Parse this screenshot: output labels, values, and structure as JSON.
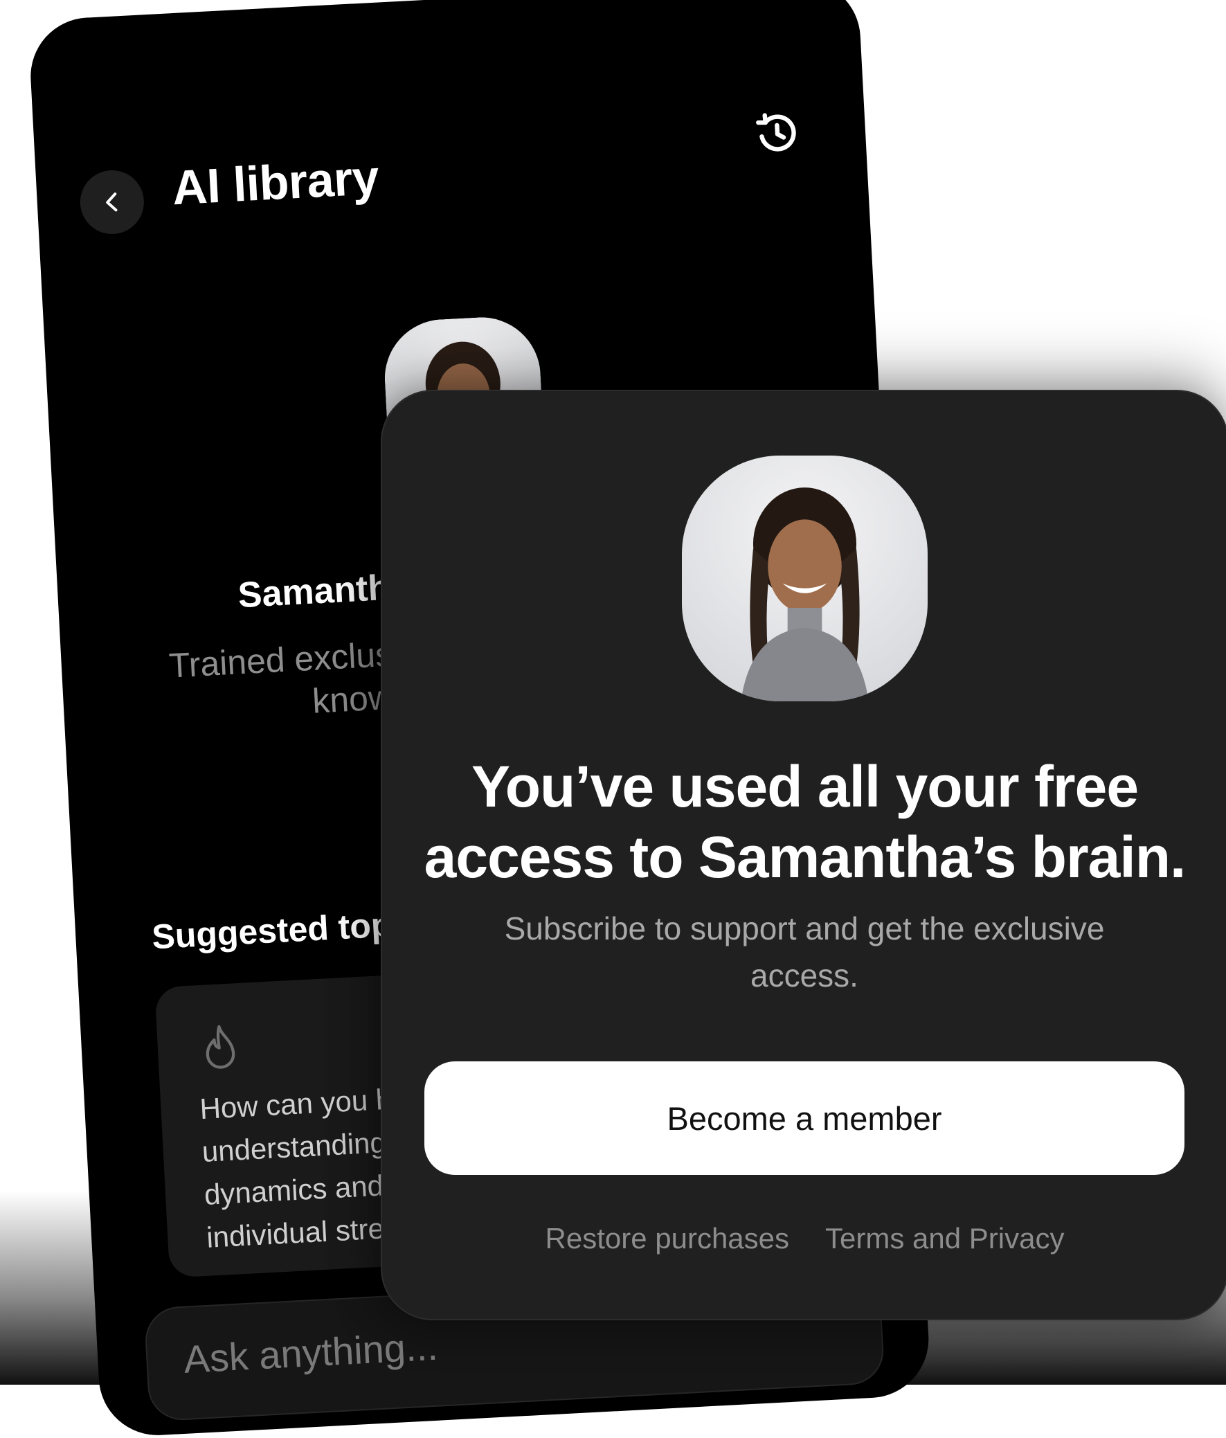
{
  "back_screen": {
    "title": "AI library",
    "icons": {
      "back": "chevron-left-icon",
      "history": "history-clock-icon",
      "topic": "flame-icon"
    },
    "profile": {
      "name": "Samantha",
      "description": "Trained exclusively on Samantha’s knowledge base"
    },
    "suggested_topics": {
      "heading": "Suggested topics",
      "items": [
        {
          "text": "How can you help in understanding team dynamics and leveraging individual strengths?"
        }
      ]
    },
    "input": {
      "placeholder": "Ask anything..."
    }
  },
  "modal": {
    "title_line1": "You’ve used all your free",
    "title_line2": "access to Samantha’s brain.",
    "subtitle": "Subscribe to support and get the exclusive access.",
    "cta_label": "Become a member",
    "links": {
      "restore": "Restore purchases",
      "terms": "Terms and Privacy"
    }
  },
  "colors": {
    "screen_bg": "#000000",
    "modal_bg": "#202020",
    "cta_bg": "#ffffff",
    "muted_text": "#8d8d8d"
  }
}
